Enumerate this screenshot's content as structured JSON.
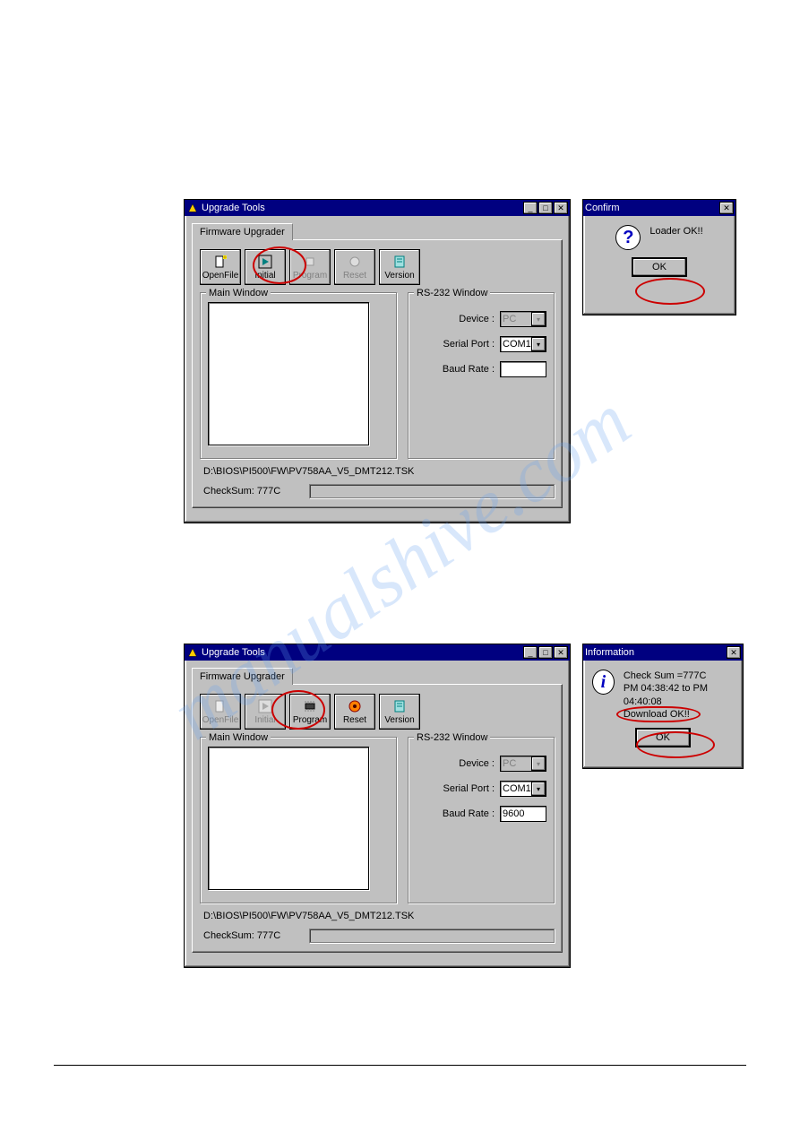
{
  "watermark": "manualshive.com",
  "window1": {
    "title": "Upgrade Tools",
    "tab": "Firmware Upgrader",
    "buttons": {
      "openfile": "OpenFile",
      "initial": "Initial",
      "program": "Program",
      "reset": "Reset",
      "version": "Version"
    },
    "main_window_label": "Main Window",
    "rs232_label": "RS-232 Window",
    "device_label": "Device :",
    "device_value": "PC",
    "serial_label": "Serial Port :",
    "serial_value": "COM1",
    "baud_label": "Baud Rate :",
    "baud_value": "",
    "path": "D:\\BIOS\\PI500\\FW\\PV758AA_V5_DMT212.TSK",
    "checksum_label": "CheckSum: 777C"
  },
  "confirm": {
    "title": "Confirm",
    "message": "Loader OK!!",
    "ok": "OK"
  },
  "window2": {
    "title": "Upgrade Tools",
    "tab": "Firmware Upgrader",
    "buttons": {
      "openfile": "OpenFile",
      "initial": "Initial",
      "program": "Program",
      "reset": "Reset",
      "version": "Version"
    },
    "main_window_label": "Main Window",
    "rs232_label": "RS-232 Window",
    "device_label": "Device :",
    "device_value": "PC",
    "serial_label": "Serial Port :",
    "serial_value": "COM1",
    "baud_label": "Baud Rate :",
    "baud_value": "9600",
    "path": "D:\\BIOS\\PI500\\FW\\PV758AA_V5_DMT212.TSK",
    "checksum_label": "CheckSum: 777C"
  },
  "information": {
    "title": "Information",
    "line1": "Check Sum =777C",
    "line2": "PM 04:38:42 to PM 04:40:08",
    "line3": "Download OK!!",
    "ok": "OK"
  }
}
